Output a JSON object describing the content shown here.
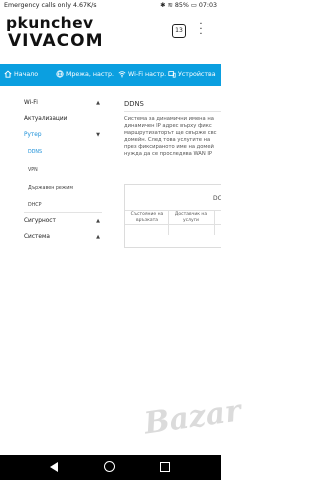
{
  "status_bar": {
    "carrier_text": "Emergency calls only",
    "net_speed": "4.67K/s",
    "battery": "85%",
    "time": "07:03"
  },
  "browser": {
    "username_overlay": "pkunchev",
    "tab_count": "13"
  },
  "brand": {
    "logo_text": "VIVACOM"
  },
  "top_nav": {
    "color": "#0b9fe0",
    "items": [
      {
        "label": "Начало",
        "icon": "home-icon"
      },
      {
        "label": "Мрежа, настр.",
        "icon": "globe-icon"
      },
      {
        "label": "Wi-Fi настр.",
        "icon": "wifi-icon"
      },
      {
        "label": "Устройства",
        "icon": "devices-icon"
      }
    ]
  },
  "sidebar": {
    "sections": [
      {
        "label": "Wi-Fi"
      },
      {
        "label": "Актуализации"
      },
      {
        "label": "Рутер"
      },
      {
        "label": "Сигурност"
      },
      {
        "label": "Система"
      }
    ],
    "router_items": [
      "DDNS",
      "VPN",
      "Държавен режим",
      "DHCP"
    ],
    "active_item": "DDNS",
    "active_color": "#1a8fd8"
  },
  "content": {
    "title": "DDNS",
    "description_lines": [
      "Система за динамични имена на",
      "динамичен IP адрес върху фикс",
      "маршрутизаторът ще свърже свс",
      "домейн. След това услугите на",
      "през фиксираното име на домей",
      "нужда да се проследява WAN IP"
    ],
    "panel_title": "DC",
    "table_headers": [
      "Състояние на връзката",
      "Доставчик на услуги"
    ]
  },
  "watermark": "Bazar"
}
